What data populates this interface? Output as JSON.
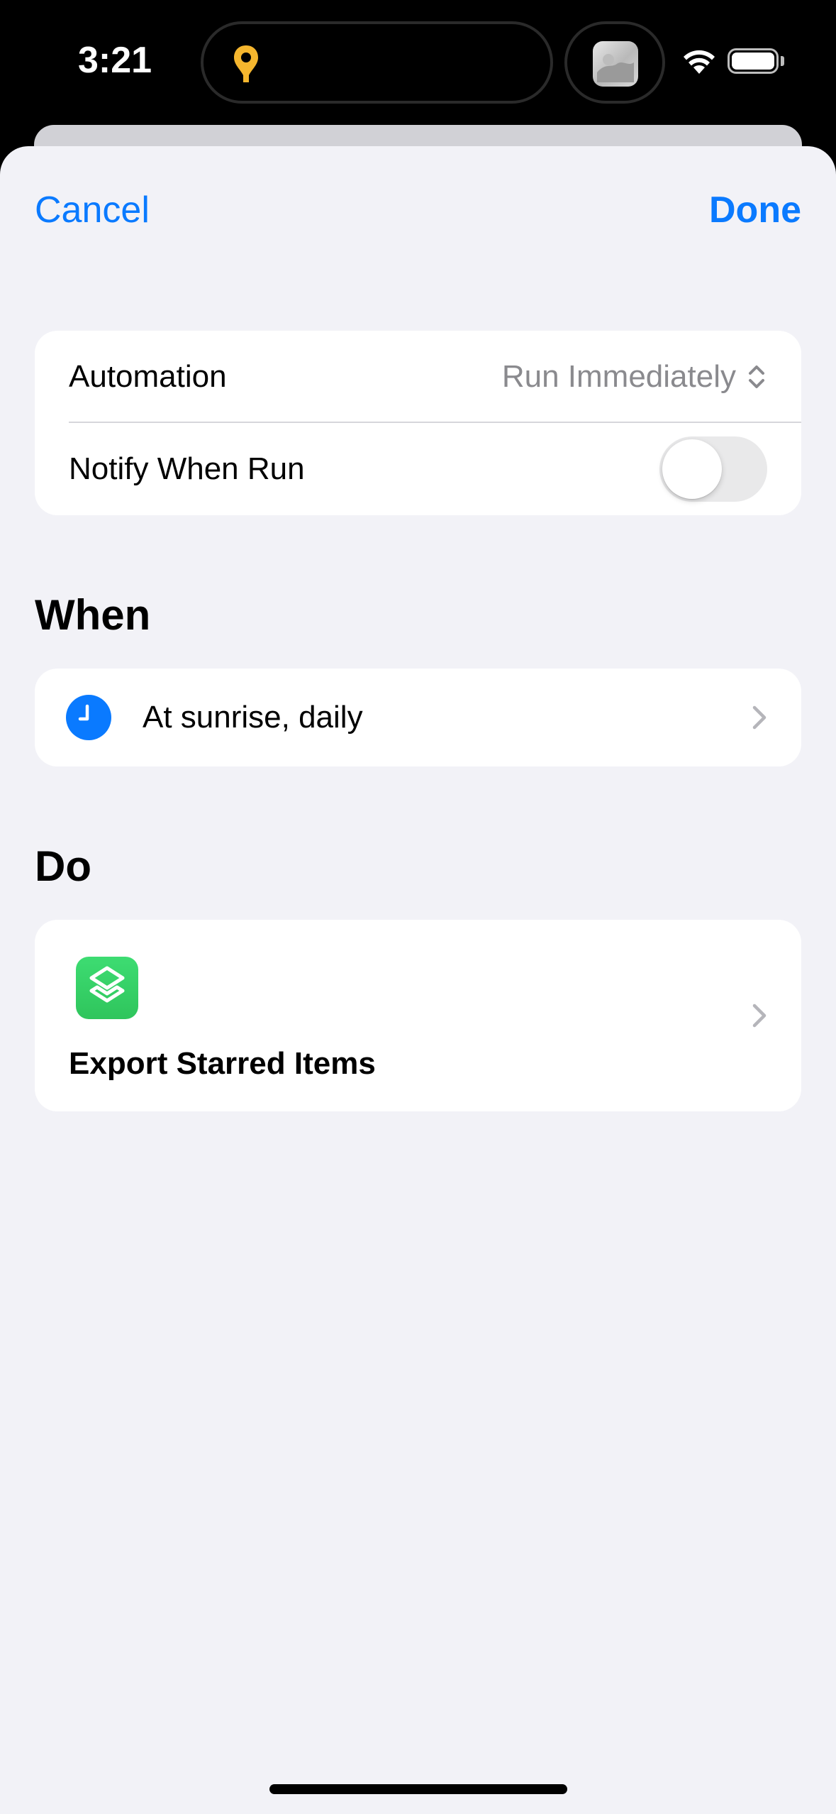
{
  "status_bar": {
    "time": "3:21"
  },
  "nav": {
    "cancel_label": "Cancel",
    "done_label": "Done"
  },
  "settings": {
    "automation_label": "Automation",
    "automation_value": "Run Immediately",
    "notify_label": "Notify When Run",
    "notify_on": false
  },
  "when": {
    "section_title": "When",
    "trigger_label": "At sunrise, daily"
  },
  "do": {
    "section_title": "Do",
    "shortcut_name": "Export Starred Items"
  },
  "colors": {
    "accent": "#0a7aff",
    "shortcut_green": "#34c759",
    "background": "#f2f2f7",
    "pin_yellow": "#f5b62e"
  }
}
